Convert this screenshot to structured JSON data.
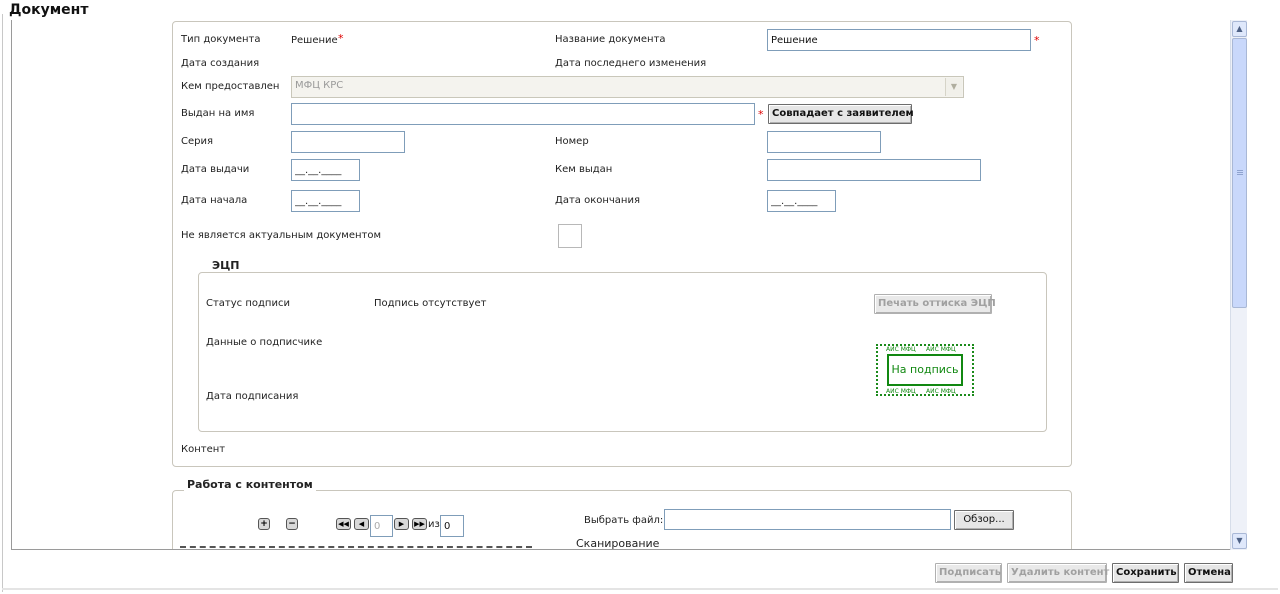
{
  "window": {
    "title": "Документ"
  },
  "doc": {
    "type_label": "Тип документа",
    "type_value": "Решение",
    "name_label": "Название документа",
    "name_value": "Решение",
    "created_label": "Дата создания",
    "modified_label": "Дата последнего изменения",
    "provided_by_label": "Кем предоставлен",
    "provided_by_value": "МФЦ КРС",
    "issued_to_label": "Выдан на имя",
    "issued_to_value": "",
    "same_as_applicant_button": "Совпадает с заявителем",
    "series_label": "Серия",
    "number_label": "Номер",
    "issue_date_label": "Дата выдачи",
    "issued_by_label": "Кем выдан",
    "start_date_label": "Дата начала",
    "end_date_label": "Дата окончания",
    "date_mask": "__.__.____",
    "not_actual_label": "Не является актуальным документом",
    "content_label": "Контент"
  },
  "signature": {
    "legend": "ЭЦП",
    "status_label": "Статус подписи",
    "status_value": "Подпись отсутствует",
    "print_button": "Печать оттиска ЭЦП",
    "signer_label": "Данные о подписчике",
    "date_label": "Дата подписания",
    "stamp_text": "На подпись",
    "stamp_border_text": "АИС МФЦ"
  },
  "content_work": {
    "legend": "Работа с контентом",
    "zoom_in": "+",
    "zoom_out": "−",
    "page_value": "0",
    "of_label": "из",
    "total_value": "0",
    "choose_file_label": "Выбрать файл:",
    "browse_button": "Обзор...",
    "scan_legend": "Сканирование"
  },
  "footer": {
    "sign_button": "Подписать",
    "delete_content_button": "Удалить контент",
    "save_button": "Сохранить",
    "cancel_button": "Отмена"
  },
  "colors": {
    "required": "#dd0000",
    "stamp": "#118811",
    "scrollbar": "#c9d8fb"
  }
}
